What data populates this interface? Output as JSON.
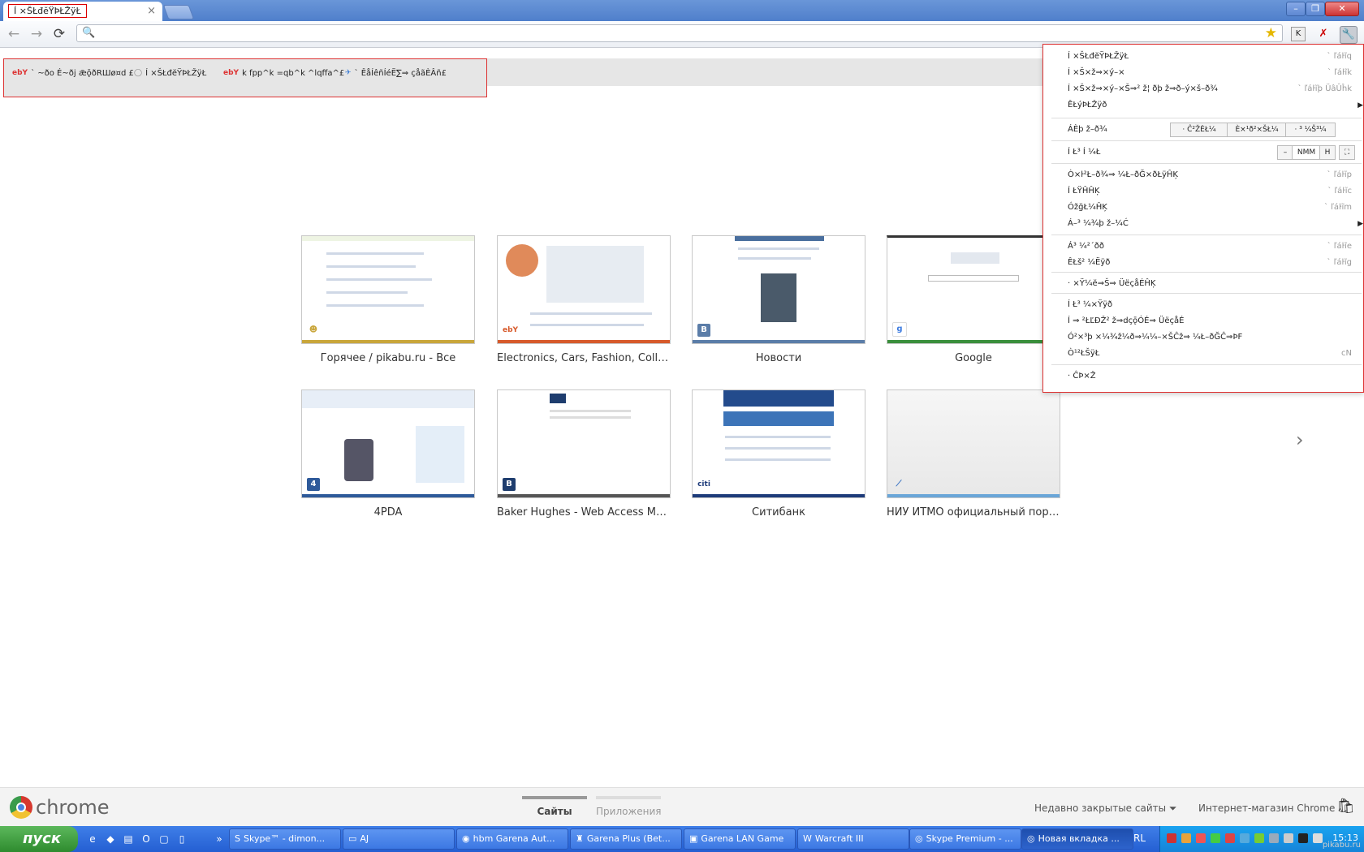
{
  "window": {
    "tab_title": "Í ×ŠŁđĕŸÞŁŽÿŁ",
    "tab_close": "×",
    "min": "–",
    "max": "❐",
    "close": "✕"
  },
  "toolbar": {
    "back": "←",
    "forward": "→",
    "reload": "⟳",
    "search_glyph": "🔍",
    "address_value": "",
    "star": "★",
    "ext1": "K",
    "ext2": "✗",
    "wrench": "🔧"
  },
  "bookmarks": [
    {
      "icon": "ebY",
      "label": "` ~ðo É~ðj  ǣǭðRШø¤d £"
    },
    {
      "icon": "◯",
      "label": "Í ×ŠŁđĕŸÞŁŽÿŁ"
    },
    {
      "icon": "ebY",
      "label": "k fpp^k =qb^k ^lqffa^£"
    },
    {
      "icon": "✈",
      "label": "` ĚåÍêñÍéË∑⇒ çåãÈÂñ£"
    }
  ],
  "thumbnails": [
    {
      "caption": "Горячее / pikabu.ru - Все",
      "fav": "☻",
      "bar_color": "#c9a63b",
      "fav_color": "#c9a63b"
    },
    {
      "caption": "Electronics, Cars, Fashion, Collect...",
      "fav": "ebY",
      "bar_color": "#d75a2b",
      "fav_color": "#ffffff"
    },
    {
      "caption": "Новости",
      "fav": "B",
      "bar_color": "#5b7da8",
      "fav_color": "#5b7da8"
    },
    {
      "caption": "Google",
      "fav": "g",
      "bar_color": "#3a8f3c",
      "fav_color": "#3c7be0"
    },
    {
      "caption": "4PDA",
      "fav": "4",
      "bar_color": "#2e5a9a",
      "fav_color": "#2e5a9a"
    },
    {
      "caption": "Baker Hughes - Web Access Man...",
      "fav": "B",
      "bar_color": "#555555",
      "fav_color": "#1e3d6e"
    },
    {
      "caption": "Ситибанк",
      "fav": "citi",
      "bar_color": "#1d3b7a",
      "fav_color": "#1d3b7a"
    },
    {
      "caption": "НИУ ИТМО официальный порт...",
      "fav": "⟋",
      "bar_color": "#6aa6d8",
      "fav_color": "#3b74c4"
    }
  ],
  "next_arrow": "›",
  "menu": {
    "items_top": [
      {
        "label": "Í ×ŠŁđĕŸÞŁŽÿŁ",
        "sc": "` ľáŀĩq"
      },
      {
        "label": "Í ×Š×ž⇒×ý–×",
        "sc": "` ľáŀĩk"
      },
      {
        "label": "Í ×Š×ž⇒×ý–×Š⇒² ž¦  ðþ ž⇒ð–ý×š–ð¾",
        "sc": "` ľáŀĩþ ÜâÛĥk"
      },
      {
        "label": "ÊŁýÞŁŽÿð",
        "sc": "",
        "submenu": true
      }
    ],
    "edit_label": "ÁÈþ ž–ð¾",
    "edit_btns": [
      "· Ĉ²ŽĖŁ¼",
      "È×¹ð²×ŠŁ¼",
      "· ³ ¼Š³¼"
    ],
    "zoom_label": "Í Ł³ Í  ¼Ł",
    "zoom_minus": "–",
    "zoom_value": "NMM",
    "zoom_plus": "H",
    "zoom_full": "⛶",
    "items_mid": [
      {
        "label": "Ò×ŀ²Ł–ð¾⇒ ¼Ł–ðĞ×ðŁÿĤĶ",
        "sc": "` ľáŀĩp"
      },
      {
        "label": "Í ŁŸĤĤĶ",
        "sc": "` ľáŀĩc"
      },
      {
        "label": "ÓžğŁ¼ĤĶ",
        "sc": "` ľáŀĩm"
      },
      {
        "label": "Á–³ ¼¾þ ž–¼Ć",
        "sc": "",
        "submenu": true
      }
    ],
    "items_low": [
      {
        "label": "Á³ ¼²´ðð",
        "sc": "` ľáŀĩe"
      },
      {
        "label": "ÊŁš² ¼Ëÿð",
        "sc": "` ľáŀĩg"
      }
    ],
    "item_sign": "· ×Ÿ¼ĕ⇒Š⇒ ÜëçåÉĤĶ",
    "items_bottom": [
      {
        "label": "Í Ł³ ¼×Ÿÿð",
        "sc": ""
      },
      {
        "label": "Í ⇒ ²ŁĽÐŽ² ž⇒dçǭÓÉ⇒ ÜëçåÉ",
        "sc": ""
      },
      {
        "label": "Ó²×³þ ×¼¾ž¼ð⇒¼¼–×ŠĈž⇒ ¼Ł–ðĞĈ⇒ÞF",
        "sc": ""
      },
      {
        "label": "Ò¹²ŁŠÿŁ",
        "sc": "cN"
      }
    ],
    "item_exit": "· ĈÞ×Ž"
  },
  "footer": {
    "chrome_word": "chrome",
    "tab_sites": "Сайты",
    "tab_apps": "Приложения",
    "recent": "Недавно закрытые сайты ⏷",
    "store": "Интернет-магазин Chrome"
  },
  "taskbar": {
    "start": "пуск",
    "tasks": [
      {
        "icon": "S",
        "label": "Skype™ - dimon...",
        "active": false
      },
      {
        "icon": "▭",
        "label": "AJ",
        "active": false
      },
      {
        "icon": "◉",
        "label": "hbm Garena Aut...",
        "active": false
      },
      {
        "icon": "♜",
        "label": "Garena Plus (Bet...",
        "active": false
      },
      {
        "icon": "▣",
        "label": "Garena LAN Game",
        "active": false
      },
      {
        "icon": "W",
        "label": "Warcraft III",
        "active": false
      },
      {
        "icon": "◎",
        "label": "Skype Premium - ...",
        "active": false
      },
      {
        "icon": "◎",
        "label": "Новая вкладка ...",
        "active": true
      }
    ],
    "lang": "RL",
    "clock": "15:13"
  },
  "watermark": "pikabu.ru"
}
